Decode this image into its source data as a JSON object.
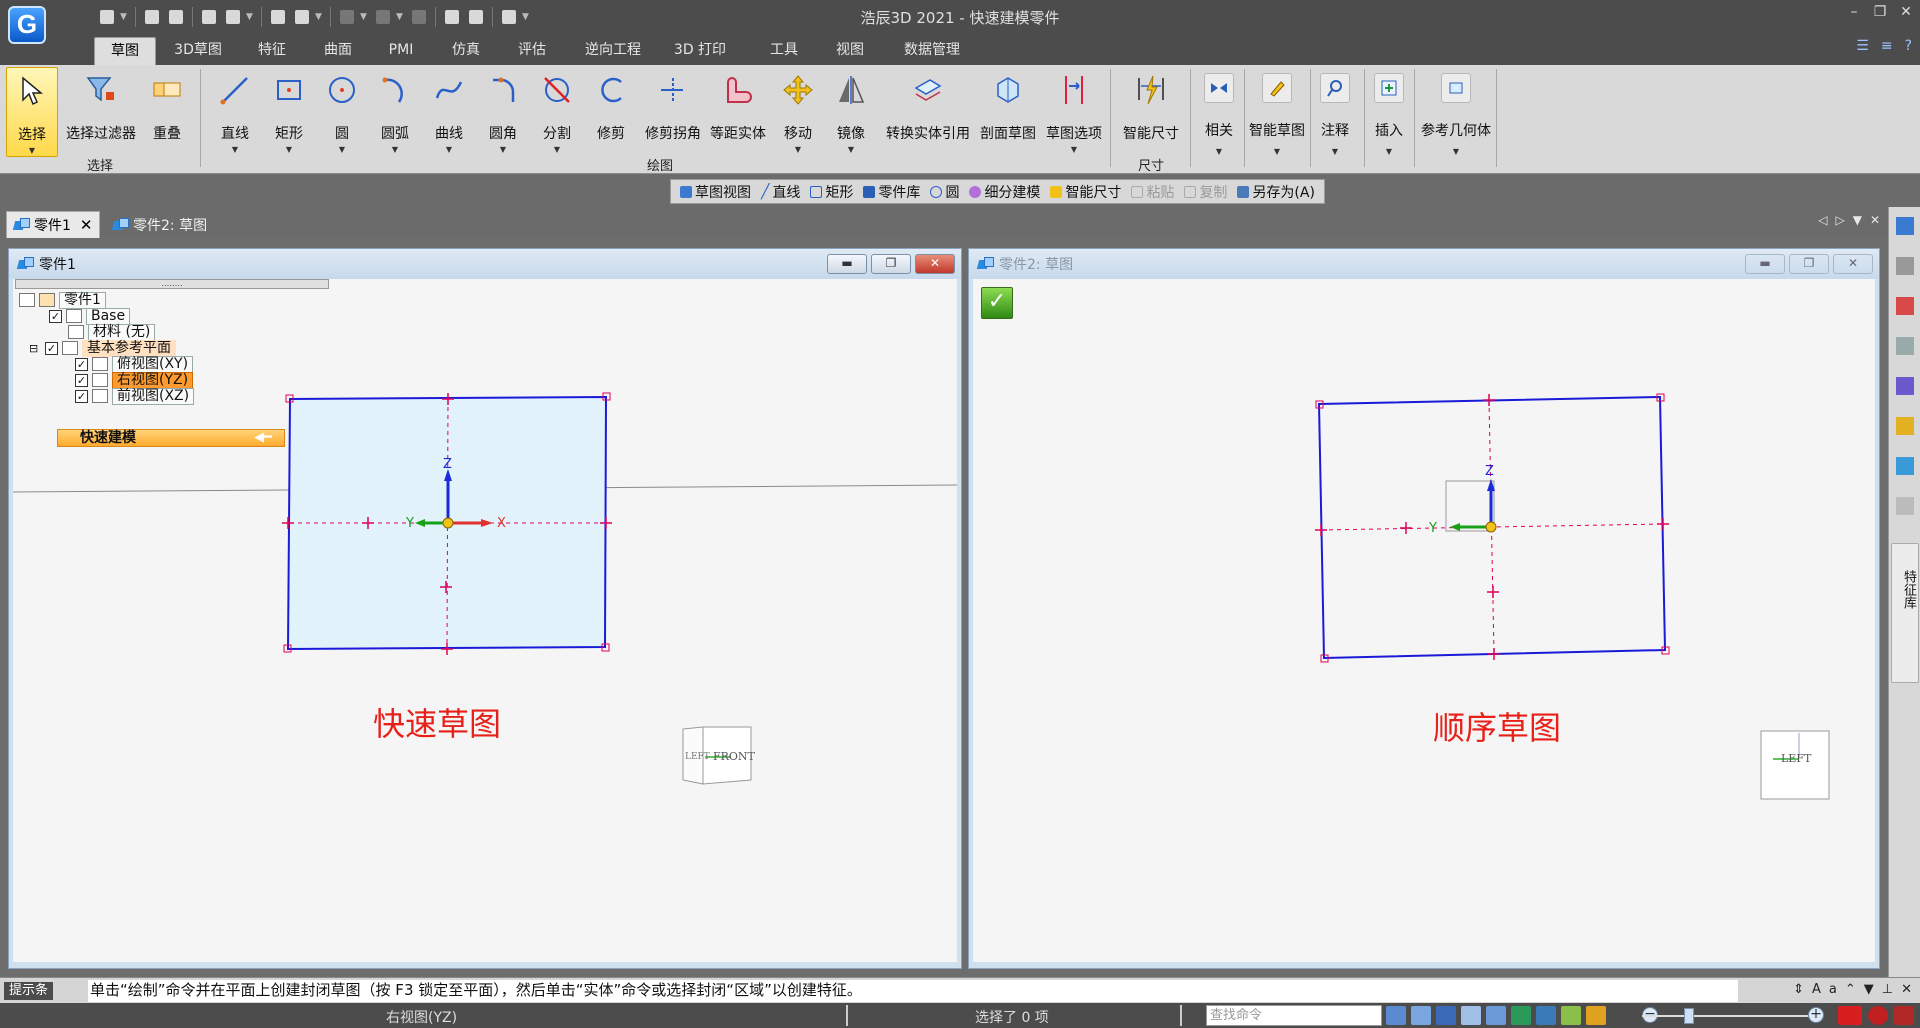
{
  "app": {
    "title": "浩辰3D 2021 - 快速建模零件",
    "logo_letter": "G"
  },
  "window_controls": {
    "minimize": "–",
    "restore": "❐",
    "close": "✕"
  },
  "ribbon_tabs": [
    "草图",
    "3D草图",
    "特征",
    "曲面",
    "PMI",
    "仿真",
    "评估",
    "逆向工程",
    "3D 打印",
    "工具",
    "视图",
    "数据管理"
  ],
  "ribbon": {
    "select_group": {
      "label": "选择",
      "buttons": [
        "选择",
        "选择过滤器",
        "重叠"
      ]
    },
    "draw_group": {
      "label": "绘图",
      "buttons": [
        "直线",
        "矩形",
        "圆",
        "圆弧",
        "曲线",
        "圆角",
        "分割",
        "修剪",
        "修剪拐角",
        "等距实体",
        "移动",
        "镜像",
        "转换实体引用",
        "剖面草图",
        "草图选项"
      ]
    },
    "dimension_group": {
      "label": "尺寸",
      "buttons": [
        "智能尺寸"
      ]
    },
    "other_buttons": [
      "相关",
      "智能草图",
      "注释",
      "插入",
      "参考几何体"
    ]
  },
  "context_toolbar": [
    {
      "label": "草图视图",
      "enabled": true
    },
    {
      "label": "直线",
      "enabled": true
    },
    {
      "label": "矩形",
      "enabled": true
    },
    {
      "label": "零件库",
      "enabled": true
    },
    {
      "label": "圆",
      "enabled": true
    },
    {
      "label": "细分建模",
      "enabled": true
    },
    {
      "label": "智能尺寸",
      "enabled": true
    },
    {
      "label": "粘贴",
      "enabled": false
    },
    {
      "label": "复制",
      "enabled": false
    },
    {
      "label": "另存为(A)",
      "enabled": true
    }
  ],
  "doc_tabs": [
    {
      "label": "零件1",
      "active": true,
      "close": "✕"
    },
    {
      "label": "零件2: 草图",
      "active": false
    }
  ],
  "windows": [
    {
      "title": "零件1",
      "tree": {
        "root": "零件1",
        "items": [
          {
            "label": "Base",
            "checked": true
          },
          {
            "label": "材料 (无)"
          },
          {
            "label": "基本参考平面",
            "checked": true,
            "expander": "⊟"
          },
          {
            "label": "俯视图(XY)",
            "checked": true
          },
          {
            "label": "右视图(YZ)",
            "checked": true,
            "selected": true
          },
          {
            "label": "前视图(XZ)",
            "checked": true
          }
        ],
        "quick_modeling": "快速建模"
      },
      "axes": {
        "z": "Z",
        "y": "Y",
        "x": "X"
      },
      "view_cube": {
        "face_front": "FRONT",
        "face_left": "LEFT"
      },
      "annotation": "快速草图"
    },
    {
      "title": "零件2: 草图",
      "axes": {
        "z": "Z",
        "y": "Y"
      },
      "view_cube": {
        "face_left": "LEFT"
      },
      "annotation": "顺序草图"
    }
  ],
  "side_panel": {
    "feature_library": "特征库"
  },
  "prompt": {
    "label": "提示条",
    "text": "单击“绘制”命令并在平面上创建封闭草图（按 F3 锁定至平面），然后单击“实体”命令或选择封闭“区域”以创建特征。"
  },
  "status": {
    "plane": "右视图(YZ)",
    "selection": "选择了 0 项",
    "search_placeholder": "查找命令"
  },
  "colors": {
    "sketch_line": "#1a1ad8",
    "sketch_fill": "#e2f2fb",
    "point_marker": "#e0005a",
    "axis_z": "#1a2ad8",
    "axis_y": "#18a018",
    "axis_x": "#e03030",
    "annotation": "#e8201a",
    "selected_node": "#ff9a2e"
  }
}
